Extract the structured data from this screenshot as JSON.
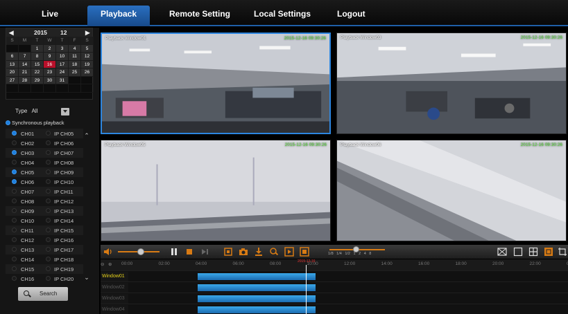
{
  "nav": {
    "tabs": [
      {
        "label": "Live"
      },
      {
        "label": "Playback"
      },
      {
        "label": "Remote Setting"
      },
      {
        "label": "Local Settings"
      },
      {
        "label": "Logout"
      }
    ],
    "active": "Playback"
  },
  "calendar": {
    "year": "2015",
    "month": "12",
    "weekdays": [
      "S",
      "M",
      "T",
      "W",
      "T",
      "F",
      "S"
    ],
    "days": [
      "",
      "",
      "1",
      "2",
      "3",
      "4",
      "5",
      "6",
      "7",
      "8",
      "9",
      "10",
      "11",
      "12",
      "13",
      "14",
      "15",
      "16",
      "17",
      "18",
      "19",
      "20",
      "21",
      "22",
      "23",
      "24",
      "25",
      "26",
      "27",
      "28",
      "29",
      "30",
      "31",
      "",
      "",
      "",
      "",
      "",
      "",
      "",
      "",
      ""
    ],
    "selected_day": "16"
  },
  "filter": {
    "type_label": "Type",
    "type_value": "All",
    "sync_label": "Synchronous playback"
  },
  "channels": [
    {
      "left": "CH01",
      "right": "IP CH05",
      "checked": true
    },
    {
      "left": "CH02",
      "right": "IP CH06",
      "checked": false
    },
    {
      "left": "CH03",
      "right": "IP CH07",
      "checked": true
    },
    {
      "left": "CH04",
      "right": "IP CH08",
      "checked": false
    },
    {
      "left": "CH05",
      "right": "IP CH09",
      "checked": true
    },
    {
      "left": "CH06",
      "right": "IP CH10",
      "checked": true
    },
    {
      "left": "CH07",
      "right": "IP CH11",
      "checked": false
    },
    {
      "left": "CH08",
      "right": "IP CH12",
      "checked": false
    },
    {
      "left": "CH09",
      "right": "IP CH13",
      "checked": false
    },
    {
      "left": "CH10",
      "right": "IP CH14",
      "checked": false
    },
    {
      "left": "CH11",
      "right": "IP CH15",
      "checked": false
    },
    {
      "left": "CH12",
      "right": "IP CH16",
      "checked": false
    },
    {
      "left": "CH13",
      "right": "IP CH17",
      "checked": false
    },
    {
      "left": "CH14",
      "right": "IP CH18",
      "checked": false
    },
    {
      "left": "CH15",
      "right": "IP CH19",
      "checked": false
    },
    {
      "left": "CH16",
      "right": "IP CH20",
      "checked": false
    }
  ],
  "search_label": "Search",
  "windows": [
    {
      "title": "Playback Window01",
      "time": "2015-12-16 09:30:26"
    },
    {
      "title": "Playback Window03",
      "time": "2015-12-16 09:30:26"
    },
    {
      "title": "Playback Window05",
      "time": "2015-12-16 09:30:26"
    },
    {
      "title": "Playback Window06",
      "time": "2015-12-16 09:30:26"
    }
  ],
  "speeds": "1/8  1/4  1/2  1  2  4  8",
  "volume_level": 0.55,
  "timeline": {
    "ticks": [
      "00:00",
      "02:00",
      "04:00",
      "06:00",
      "08:00",
      "10:00",
      "12:00",
      "14:00",
      "16:00",
      "18:00",
      "20:00",
      "22:00",
      "00:00"
    ],
    "cursor_date": "2015-12-16",
    "cursor_time": "09:30:26",
    "rows": [
      "Window01",
      "Window02",
      "Window03",
      "Window04"
    ],
    "active_row": "Window01"
  },
  "colors": {
    "accent": "#2a6fc0",
    "orange": "#d87b14",
    "selected_day": "#b8102a",
    "record_bar": "#2a8bd6",
    "osd_time": "#5be33d"
  }
}
